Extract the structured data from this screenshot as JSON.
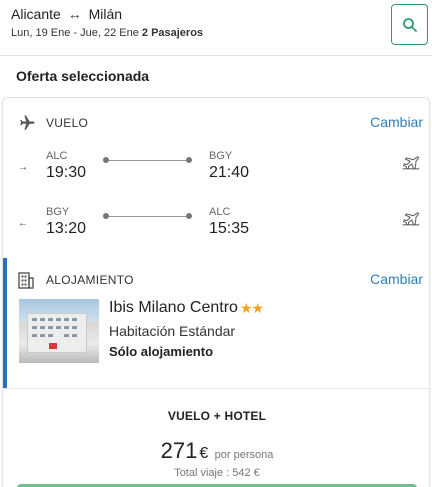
{
  "header": {
    "origin": "Alicante",
    "route_arrow": "↔",
    "destination": "Milán",
    "dates": "Lun, 19 Ene - Jue, 22 Ene",
    "passengers": "2 Pasajeros",
    "search_icon": "search-icon"
  },
  "section_title": "Oferta seleccionada",
  "flight": {
    "label": "VUELO",
    "change_label": "Cambiar",
    "icon": "airplane-icon",
    "legs": [
      {
        "direction_icon": "→",
        "from_code": "ALC",
        "from_time": "19:30",
        "to_code": "BGY",
        "to_time": "21:40",
        "status_icon": "plane-takeoff-icon"
      },
      {
        "direction_icon": "←",
        "from_code": "BGY",
        "from_time": "13:20",
        "to_code": "ALC",
        "to_time": "15:35",
        "status_icon": "plane-takeoff-icon"
      }
    ]
  },
  "accommodation": {
    "label": "ALOJAMIENTO",
    "change_label": "Cambiar",
    "icon": "building-icon",
    "hotel_name": "Ibis Milano Centro",
    "stars": "★★",
    "room_type": "Habitación Estándar",
    "board": "Sólo alojamiento"
  },
  "package": {
    "label": "VUELO + HOTEL",
    "price": "271",
    "currency": "€",
    "per_person": "por persona",
    "total": "Total viaje : 542 €"
  },
  "colors": {
    "accent_blue": "#2f6fbd",
    "link_blue": "#2f7fb8",
    "brand_green": "#2e9e6f",
    "star": "#f2a31b"
  }
}
